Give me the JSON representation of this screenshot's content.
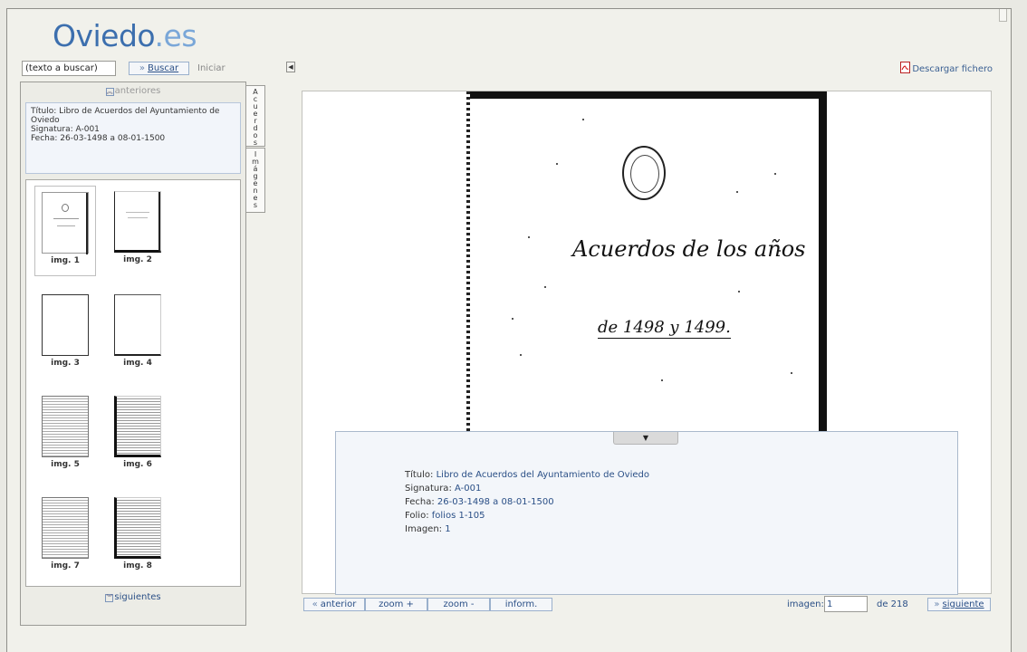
{
  "header": {
    "logo_main": "Oviedo",
    "logo_suffix": ".es",
    "search_placeholder": "(texto a buscar)",
    "search_button": "Buscar",
    "reset_link": "Iniciar",
    "download_label": "Descargar fichero"
  },
  "sidebar": {
    "prev_label": "anteriores",
    "next_label": "siguientes",
    "info": {
      "title_label": "Título:",
      "title_value": "Libro de Acuerdos del Ayuntamiento de Oviedo",
      "signature_label": "Signatura:",
      "signature_value": "A-001",
      "date_label": "Fecha:",
      "date_value": "26-03-1498 a 08-01-1500"
    },
    "thumbnails": [
      {
        "label": "img. 1",
        "kind": "cover"
      },
      {
        "label": "img. 2",
        "kind": "cover-dark"
      },
      {
        "label": "img. 3",
        "kind": "blank"
      },
      {
        "label": "img. 4",
        "kind": "blank-dark"
      },
      {
        "label": "img. 5",
        "kind": "text"
      },
      {
        "label": "img. 6",
        "kind": "text-dark"
      },
      {
        "label": "img. 7",
        "kind": "text"
      },
      {
        "label": "img. 8",
        "kind": "text-dark"
      }
    ],
    "tabs": [
      "Acuerdos",
      "Imágenes"
    ]
  },
  "document": {
    "handwriting_line1": "Acuerdos de los años",
    "handwriting_line2": "de 1498 y 1499."
  },
  "info_panel": {
    "title_label": "Título:",
    "title_value": "Libro de Acuerdos del Ayuntamiento de Oviedo",
    "signature_label": "Signatura:",
    "signature_value": "A-001",
    "date_label": "Fecha:",
    "date_value": "26-03-1498 a 08-01-1500",
    "folio_label": "Folio:",
    "folio_value": "folios 1-105",
    "image_label": "Imagen:",
    "image_value": "1"
  },
  "toolbar": {
    "prev_label": "anterior",
    "zoom_in_label": "zoom +",
    "zoom_out_label": "zoom -",
    "info_label": "inform.",
    "image_label": "imagen:",
    "current_image": "1",
    "total_label": "de 218",
    "next_label": "siguiente"
  },
  "colors": {
    "accent_blue": "#2a4f86",
    "logo_blue": "#3c6fae"
  }
}
